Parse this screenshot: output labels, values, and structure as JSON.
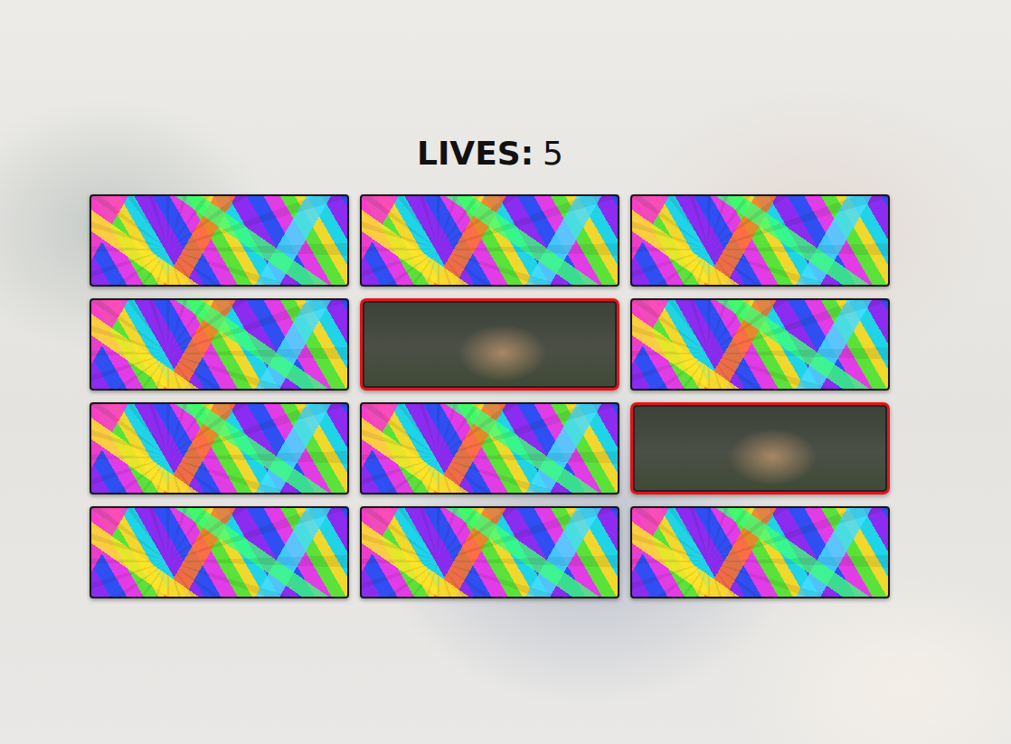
{
  "hud": {
    "label": "LIVES:",
    "value": "5"
  },
  "cards": [
    {
      "revealed": false
    },
    {
      "revealed": false
    },
    {
      "revealed": false
    },
    {
      "revealed": false
    },
    {
      "revealed": true
    },
    {
      "revealed": false
    },
    {
      "revealed": false
    },
    {
      "revealed": false
    },
    {
      "revealed": true
    },
    {
      "revealed": false
    },
    {
      "revealed": false
    },
    {
      "revealed": false
    }
  ]
}
